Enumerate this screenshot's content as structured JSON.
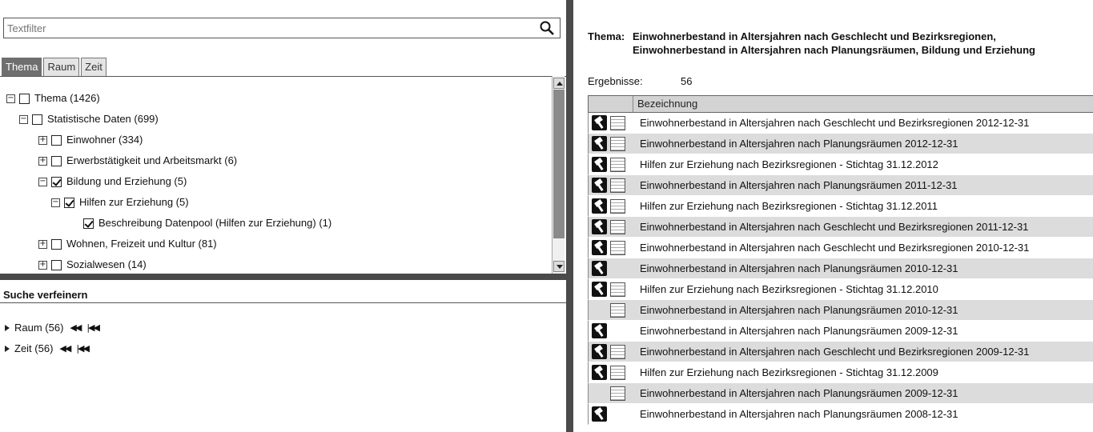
{
  "filter": {
    "placeholder": "Textfilter",
    "value": ""
  },
  "tabs": [
    {
      "label": "Thema",
      "active": true
    },
    {
      "label": "Raum",
      "active": false
    },
    {
      "label": "Zeit",
      "active": false
    }
  ],
  "tree": [
    {
      "label": "Thema (1426)",
      "level": 0,
      "toggle": "minus",
      "checkbox": true,
      "checked": false
    },
    {
      "label": "Statistische Daten (699)",
      "level": 1,
      "toggle": "minus",
      "checkbox": true,
      "checked": false
    },
    {
      "label": "Einwohner (334)",
      "level": 2,
      "toggle": "plus",
      "checkbox": true,
      "checked": false
    },
    {
      "label": "Erwerbstätigkeit und Arbeitsmarkt (6)",
      "level": 2,
      "toggle": "plus",
      "checkbox": true,
      "checked": false
    },
    {
      "label": "Bildung und Erziehung (5)",
      "level": 2,
      "toggle": "minus",
      "checkbox": true,
      "checked": true
    },
    {
      "label": "Hilfen zur Erziehung (5)",
      "level": 3,
      "toggle": "minus",
      "checkbox": true,
      "checked": true
    },
    {
      "label": "Beschreibung Datenpool (Hilfen zur Erziehung) (1)",
      "level": 4,
      "toggle": "none",
      "checkbox": true,
      "checked": true
    },
    {
      "label": "Wohnen, Freizeit und Kultur (81)",
      "level": 2,
      "toggle": "plus",
      "checkbox": true,
      "checked": false
    },
    {
      "label": "Sozialwesen (14)",
      "level": 2,
      "toggle": "plus",
      "checkbox": true,
      "checked": false
    }
  ],
  "refine": {
    "title": "Suche verfeinern",
    "items": [
      {
        "label": "Raum (56)"
      },
      {
        "label": "Zeit (56)"
      }
    ]
  },
  "thema": {
    "label": "Thema:",
    "lines": [
      "Einwohnerbestand in Altersjahren nach Geschlecht und Bezirksregionen,",
      "Einwohnerbestand in Altersjahren nach Planungsräumen, Bildung und Erziehung"
    ]
  },
  "ergebnisse": {
    "label": "Ergebnisse:",
    "count": "56"
  },
  "results": {
    "header": "Bezeichnung",
    "rows": [
      {
        "tool": true,
        "table": true,
        "text": "Einwohnerbestand in Altersjahren nach Geschlecht und Bezirksregionen 2012-12-31"
      },
      {
        "tool": true,
        "table": true,
        "text": "Einwohnerbestand in Altersjahren nach Planungsräumen 2012-12-31"
      },
      {
        "tool": true,
        "table": true,
        "text": "Hilfen zur Erziehung nach Bezirksregionen - Stichtag 31.12.2012"
      },
      {
        "tool": true,
        "table": true,
        "text": "Einwohnerbestand in Altersjahren nach Planungsräumen 2011-12-31"
      },
      {
        "tool": true,
        "table": true,
        "text": "Hilfen zur Erziehung nach Bezirksregionen - Stichtag 31.12.2011"
      },
      {
        "tool": true,
        "table": true,
        "text": "Einwohnerbestand in Altersjahren nach Geschlecht und Bezirksregionen 2011-12-31"
      },
      {
        "tool": true,
        "table": true,
        "text": "Einwohnerbestand in Altersjahren nach Geschlecht und Bezirksregionen 2010-12-31"
      },
      {
        "tool": true,
        "table": false,
        "text": "Einwohnerbestand in Altersjahren nach Planungsräumen 2010-12-31"
      },
      {
        "tool": true,
        "table": true,
        "text": "Hilfen zur Erziehung nach Bezirksregionen - Stichtag 31.12.2010"
      },
      {
        "tool": false,
        "table": true,
        "text": "Einwohnerbestand in Altersjahren nach Planungsräumen 2010-12-31"
      },
      {
        "tool": true,
        "table": false,
        "text": "Einwohnerbestand in Altersjahren nach Planungsräumen 2009-12-31"
      },
      {
        "tool": true,
        "table": true,
        "text": "Einwohnerbestand in Altersjahren nach Geschlecht und Bezirksregionen 2009-12-31"
      },
      {
        "tool": true,
        "table": true,
        "text": "Hilfen zur Erziehung nach Bezirksregionen - Stichtag 31.12.2009"
      },
      {
        "tool": false,
        "table": true,
        "text": "Einwohnerbestand in Altersjahren nach Planungsräumen 2009-12-31"
      },
      {
        "tool": true,
        "table": false,
        "text": "Einwohnerbestand in Altersjahren nach Planungsräumen 2008-12-31"
      }
    ]
  }
}
